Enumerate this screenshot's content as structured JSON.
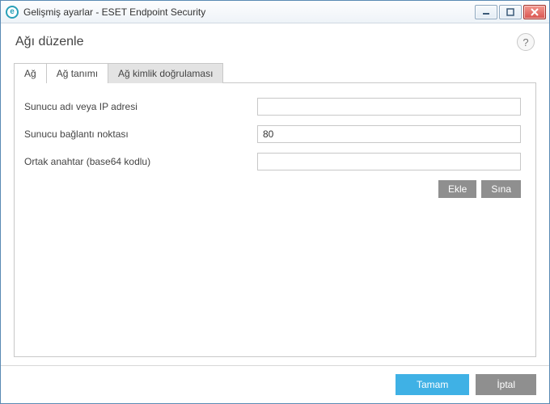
{
  "window": {
    "title": "Gelişmiş ayarlar - ESET Endpoint Security",
    "icon_letter": "e"
  },
  "page": {
    "heading": "Ağı düzenle",
    "help_symbol": "?"
  },
  "tabs": {
    "network": "Ağ",
    "network_definition": "Ağ tanımı",
    "network_auth": "Ağ kimlik doğrulaması"
  },
  "form": {
    "server_name_label": "Sunucu adı veya IP adresi",
    "server_name_value": "",
    "server_port_label": "Sunucu bağlantı noktası",
    "server_port_value": "80",
    "public_key_label": "Ortak anahtar (base64 kodlu)",
    "public_key_value": ""
  },
  "actions": {
    "add": "Ekle",
    "test": "Sına"
  },
  "footer": {
    "ok": "Tamam",
    "cancel": "İptal"
  }
}
